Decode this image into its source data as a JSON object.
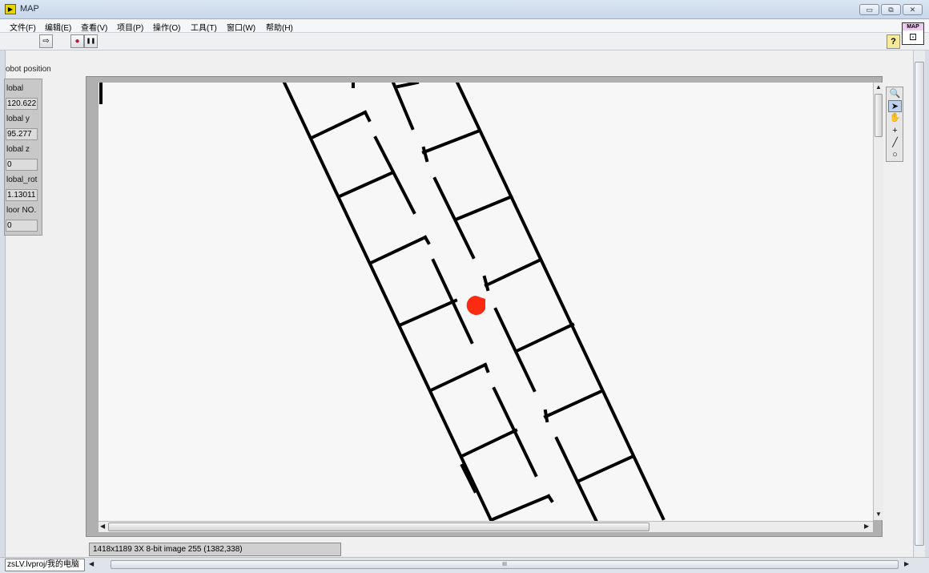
{
  "window": {
    "title": "MAP",
    "app_icon_glyph": "▶",
    "minimize_glyph": "▭",
    "restore_glyph": "⧉",
    "close_glyph": "✕"
  },
  "menu": [
    {
      "label": "文件(F)"
    },
    {
      "label": "编辑(E)"
    },
    {
      "label": "查看(V)"
    },
    {
      "label": "项目(P)"
    },
    {
      "label": "操作(O)"
    },
    {
      "label": "工具(T)"
    },
    {
      "label": "窗口(W)"
    },
    {
      "label": "帮助(H)"
    }
  ],
  "toolbar": {
    "run_glyph": "⇨",
    "abort_glyph": "●",
    "pause_glyph": "❚❚",
    "help_glyph": "?",
    "vi_icon_label": "MAP",
    "vi_icon_glyph": "⊡"
  },
  "robot_position": {
    "title": "obot position",
    "fields": [
      {
        "label": "lobal",
        "value": "120.622"
      },
      {
        "label": "lobal y",
        "value": "95.277"
      },
      {
        "label": "lobal z",
        "value": "0"
      },
      {
        "label": "lobal_rot",
        "value": "1.13011"
      },
      {
        "label": "loor NO.",
        "value": "0"
      }
    ]
  },
  "image_display": {
    "info": "1418x1189 3X 8-bit image 255     (1382,338)",
    "marker_color": "#ff2a12",
    "wall_color": "#000000",
    "background_color": "#f7f7f7",
    "palette": [
      {
        "glyph": "🔍",
        "name": "zoom-tool-icon"
      },
      {
        "glyph": "➤",
        "name": "pointer-tool-icon"
      },
      {
        "glyph": "✋",
        "name": "pan-tool-icon"
      },
      {
        "glyph": "+",
        "name": "point-tool-icon"
      },
      {
        "glyph": "╱",
        "name": "line-tool-icon"
      },
      {
        "glyph": "○",
        "name": "oval-tool-icon"
      }
    ]
  },
  "statusbar": {
    "path": "zsLV.lvproj/我的电脑",
    "grip": "III"
  }
}
